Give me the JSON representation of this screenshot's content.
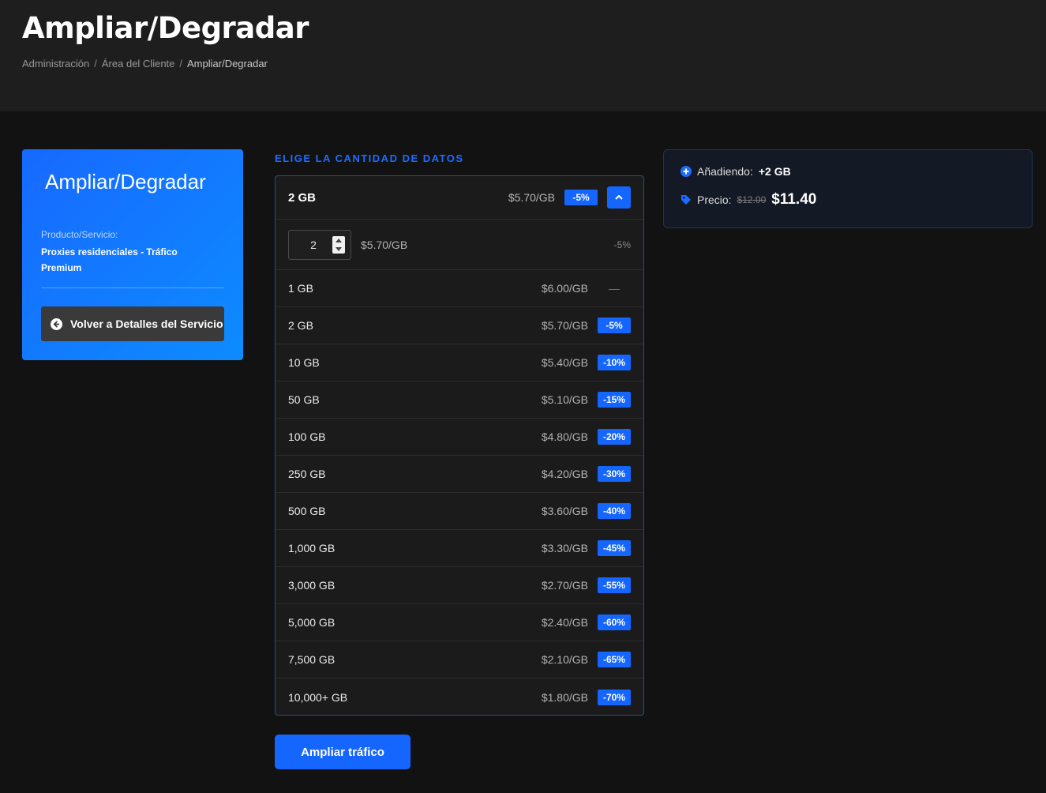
{
  "header": {
    "title": "Ampliar/Degradar",
    "breadcrumb": [
      "Administración",
      "Área del Cliente",
      "Ampliar/Degradar"
    ]
  },
  "sidebar": {
    "title": "Ampliar/Degradar",
    "product_label": "Producto/Servicio:",
    "product_name": "Proxies residenciales - Tráfico Premium",
    "back_button": "Volver a Detalles del Servicio"
  },
  "selector": {
    "section_label": "ELIGE LA CANTIDAD DE DATOS",
    "selected": {
      "amount": "2 GB",
      "price": "$5.70/GB",
      "discount": "-5%"
    },
    "custom": {
      "quantity": "2",
      "price": "$5.70/GB",
      "discount": "-5%"
    },
    "options": [
      {
        "amount": "1 GB",
        "price": "$6.00/GB",
        "discount": "—"
      },
      {
        "amount": "2 GB",
        "price": "$5.70/GB",
        "discount": "-5%"
      },
      {
        "amount": "10 GB",
        "price": "$5.40/GB",
        "discount": "-10%"
      },
      {
        "amount": "50 GB",
        "price": "$5.10/GB",
        "discount": "-15%"
      },
      {
        "amount": "100 GB",
        "price": "$4.80/GB",
        "discount": "-20%"
      },
      {
        "amount": "250 GB",
        "price": "$4.20/GB",
        "discount": "-30%"
      },
      {
        "amount": "500 GB",
        "price": "$3.60/GB",
        "discount": "-40%"
      },
      {
        "amount": "1,000 GB",
        "price": "$3.30/GB",
        "discount": "-45%"
      },
      {
        "amount": "3,000 GB",
        "price": "$2.70/GB",
        "discount": "-55%"
      },
      {
        "amount": "5,000 GB",
        "price": "$2.40/GB",
        "discount": "-60%"
      },
      {
        "amount": "7,500 GB",
        "price": "$2.10/GB",
        "discount": "-65%"
      },
      {
        "amount": "10,000+ GB",
        "price": "$1.80/GB",
        "discount": "-70%"
      }
    ],
    "submit_label": "Ampliar tráfico"
  },
  "summary": {
    "adding_label": "Añadiendo:",
    "adding_value": "+2 GB",
    "price_label": "Precio:",
    "old_price": "$12.00",
    "new_price": "$11.40"
  },
  "colors": {
    "accent": "#1565ff",
    "background": "#121212",
    "panel": "#1b1b1b"
  }
}
